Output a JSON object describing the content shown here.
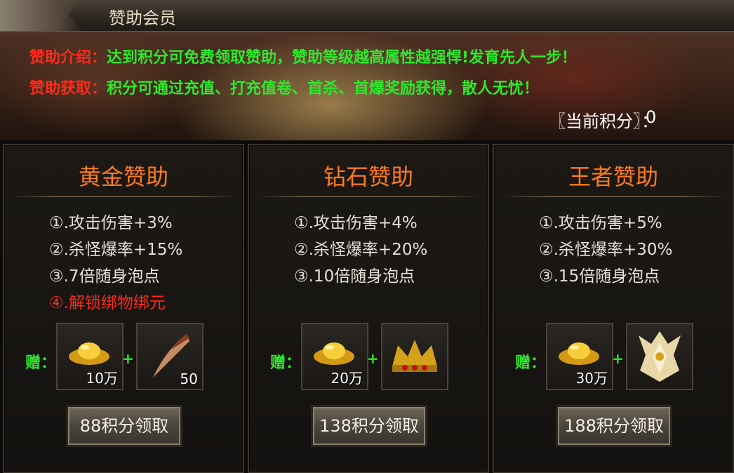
{
  "header": {
    "title": "赞助会员"
  },
  "info": {
    "intro_label": "赞助介绍：",
    "intro_text": "达到积分可免费领取赞助，赞助等级越高属性越强悍!发育先人一步！",
    "obtain_label": "赞助获取：",
    "obtain_text": "积分可通过充值、打充值卷、首杀、首爆奖励获得，散人无忧！",
    "score_label": "〖当前积分〗：",
    "score_value": "0"
  },
  "cards": [
    {
      "name": "黄金赞助",
      "perks": [
        "①.攻击伤害+3%",
        "②.杀怪爆率+15%",
        "③.7倍随身泡点",
        "④.解锁绑物绑元"
      ],
      "gift_label": "赠：",
      "items": [
        {
          "icon": "gold-ingot-icon",
          "qty": "10万"
        },
        {
          "icon": "claw-icon",
          "qty": "50"
        }
      ],
      "claim_label": "88积分领取"
    },
    {
      "name": "钻石赞助",
      "perks": [
        "①.攻击伤害+4%",
        "②.杀怪爆率+20%",
        "③.10倍随身泡点"
      ],
      "gift_label": "赠：",
      "items": [
        {
          "icon": "gold-ingot-icon",
          "qty": "20万"
        },
        {
          "icon": "crown-icon",
          "qty": ""
        }
      ],
      "claim_label": "138积分领取"
    },
    {
      "name": "王者赞助",
      "perks": [
        "①.攻击伤害+5%",
        "②.杀怪爆率+30%",
        "③.15倍随身泡点"
      ],
      "gift_label": "赠：",
      "items": [
        {
          "icon": "gold-ingot-icon",
          "qty": "30万"
        },
        {
          "icon": "winged-emblem-icon",
          "qty": ""
        }
      ],
      "claim_label": "188积分领取"
    }
  ],
  "plus_sign": "+",
  "colors": {
    "accent_orange": "#ff7a1c",
    "label_red": "#ff2a1a",
    "text_green": "#2ee82e"
  }
}
